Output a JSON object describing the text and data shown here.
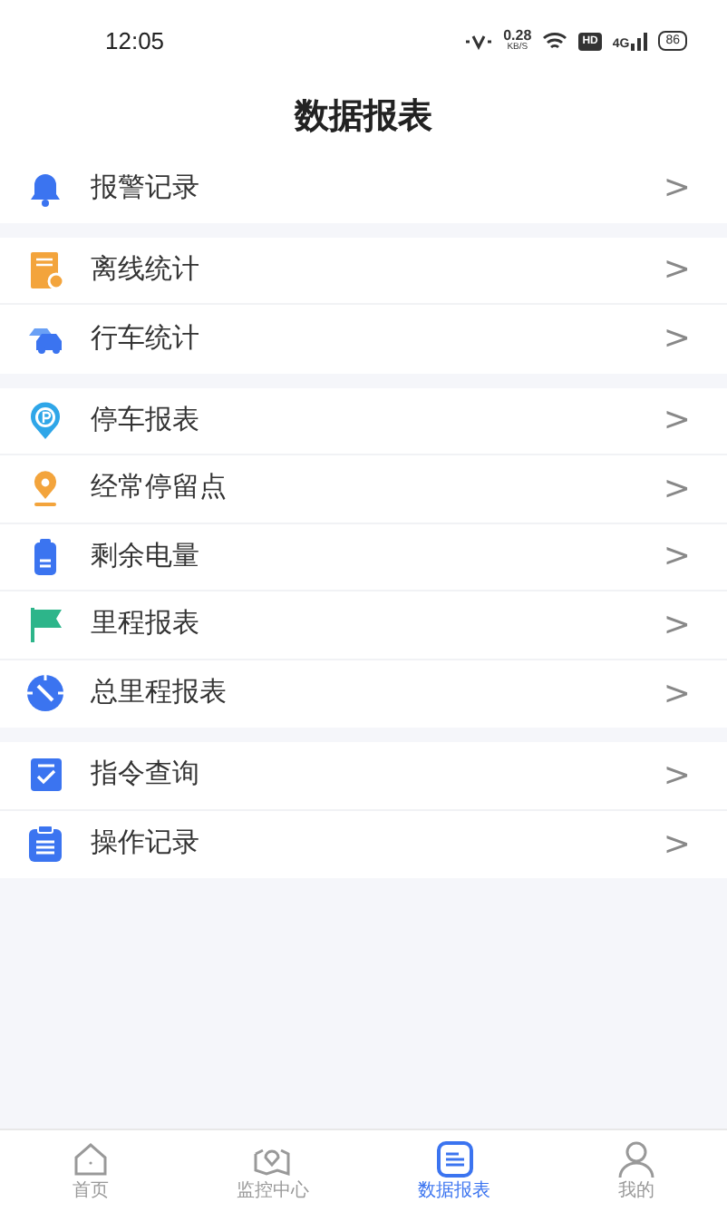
{
  "status_bar": {
    "time": "12:05",
    "speed": "0.28",
    "speed_unit": "KB/S",
    "hd": "HD",
    "network": "4G",
    "battery": "86"
  },
  "title": "数据报表",
  "groups": [
    {
      "items": [
        {
          "label": "报警记录",
          "kind": "bell"
        }
      ]
    },
    {
      "items": [
        {
          "label": "离线统计",
          "kind": "offline"
        },
        {
          "label": "行车统计",
          "kind": "cars"
        }
      ]
    },
    {
      "items": [
        {
          "label": "停车报表",
          "kind": "parking"
        },
        {
          "label": "经常停留点",
          "kind": "pin"
        },
        {
          "label": "剩余电量",
          "kind": "battery"
        },
        {
          "label": "里程报表",
          "kind": "flag"
        },
        {
          "label": "总里程报表",
          "kind": "compass"
        }
      ]
    },
    {
      "items": [
        {
          "label": "指令查询",
          "kind": "check"
        },
        {
          "label": "操作记录",
          "kind": "clipboard"
        }
      ]
    }
  ],
  "chevron": ">",
  "tabs": [
    {
      "label": "首页",
      "kind": "home",
      "selected": false
    },
    {
      "label": "监控中心",
      "kind": "map",
      "selected": false
    },
    {
      "label": "数据报表",
      "kind": "report",
      "selected": true
    },
    {
      "label": "我的",
      "kind": "user",
      "selected": false
    }
  ]
}
